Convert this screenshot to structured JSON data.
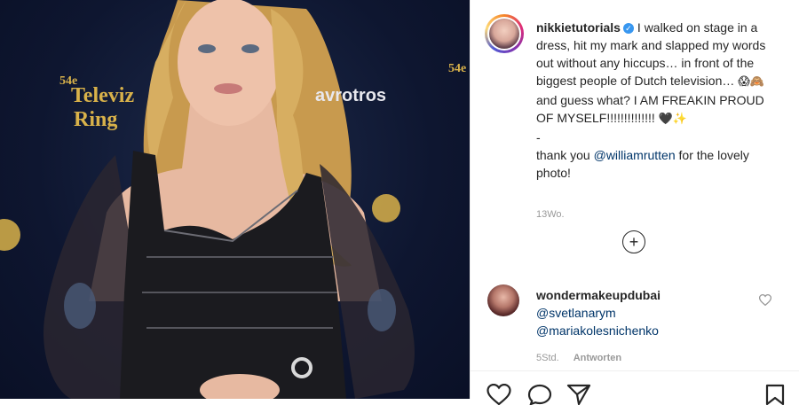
{
  "photo": {
    "backdrop": {
      "left_edition": "54e",
      "brand_left_1": "Televiz",
      "brand_left_2": "Ring",
      "brand_center": "avrotros",
      "right_edition": "54e"
    }
  },
  "post": {
    "username": "nikkietutorials",
    "verified_glyph": "✓",
    "caption_1": "I walked on stage in a dress, hit my mark and slapped my words out without any hiccups… in front of the biggest people of Dutch television… ",
    "caption_emoji_1": "😱🙈",
    "caption_2": " and guess what? I AM FREAKIN PROUD OF MYSELF!!!!!!!!!!!!!! ",
    "caption_emoji_2": "🖤✨",
    "caption_dash": "-",
    "thanks_prefix": "thank you ",
    "thanks_mention": "@williamrutten",
    "thanks_suffix": " for the lovely photo!",
    "time": "13Wo.",
    "load_more_symbol": "+"
  },
  "comment": {
    "username": "wondermakeupdubai",
    "mention_1": "@svetlanarym",
    "mention_2": "@mariakolesnichenko",
    "time": "5Std.",
    "reply_label": "Antworten"
  },
  "icons": {
    "post_avatar": "avatar-icon",
    "verified": "verified-badge-icon",
    "load_more": "plus-circle-icon",
    "comment_like": "heart-outline-icon",
    "like": "heart-outline-icon",
    "comment": "speech-bubble-icon",
    "share": "paper-plane-icon",
    "save": "bookmark-icon"
  },
  "colors": {
    "text": "#262626",
    "muted": "#999999",
    "mention": "#003569",
    "verified": "#3897f0",
    "brand_gold": "#d9b24a"
  }
}
